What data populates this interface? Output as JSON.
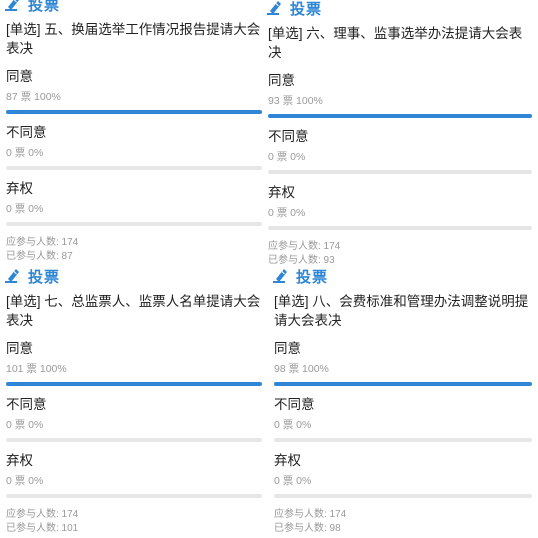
{
  "vote_label": "投票",
  "total_label": "应参与人数",
  "voted_label": "已参与人数",
  "panels": [
    {
      "question": "[单选] 五、换届选举工作情况报告提请大会表决",
      "options": [
        {
          "name": "同意",
          "stat": "87 票  100%",
          "fraction": 1.0
        },
        {
          "name": "不同意",
          "stat": "0 票  0%",
          "fraction": 0.0
        },
        {
          "name": "弃权",
          "stat": "0 票  0%",
          "fraction": 0.0
        }
      ],
      "total": "应参与人数: 174",
      "voted": "已参与人数: 87"
    },
    {
      "question": "[单选] 六、理事、监事选举办法提请大会表决",
      "options": [
        {
          "name": "同意",
          "stat": "93 票  100%",
          "fraction": 1.0
        },
        {
          "name": "不同意",
          "stat": "0 票  0%",
          "fraction": 0.0
        },
        {
          "name": "弃权",
          "stat": "0 票  0%",
          "fraction": 0.0
        }
      ],
      "total": "应参与人数: 174",
      "voted": "已参与人数: 93"
    },
    {
      "question": "[单选] 七、总监票人、监票人名单提请大会表决",
      "options": [
        {
          "name": "同意",
          "stat": "101 票  100%",
          "fraction": 1.0
        },
        {
          "name": "不同意",
          "stat": "0 票  0%",
          "fraction": 0.0
        },
        {
          "name": "弃权",
          "stat": "0 票  0%",
          "fraction": 0.0
        }
      ],
      "total": "应参与人数: 174",
      "voted": "已参与人数: 101"
    },
    {
      "question": "[单选] 八、会费标准和管理办法调整说明提请大会表决",
      "options": [
        {
          "name": "同意",
          "stat": "98 票  100%",
          "fraction": 1.0
        },
        {
          "name": "不同意",
          "stat": "0 票  0%",
          "fraction": 0.0
        },
        {
          "name": "弃权",
          "stat": "0 票  0%",
          "fraction": 0.0
        }
      ],
      "total": "应参与人数: 174",
      "voted": "已参与人数: 98"
    }
  ],
  "colors": {
    "accent": "#2f86d6",
    "track": "#e6e6e6",
    "muted": "#9a9a9a"
  },
  "icons": {
    "vote": "edit-pencil-icon"
  }
}
